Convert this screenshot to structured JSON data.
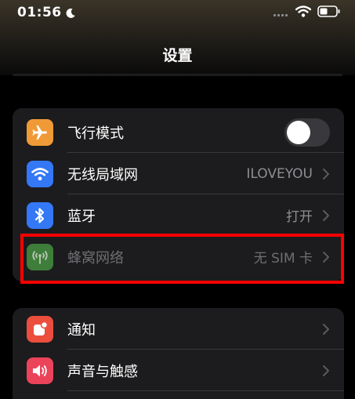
{
  "status_bar": {
    "time": "01:56",
    "focus_icon": "moon-icon",
    "signal_icon": "signal-icon",
    "wifi_icon": "wifi-icon",
    "battery_icon": "battery-icon"
  },
  "nav": {
    "title": "设置"
  },
  "group1": [
    {
      "icon": "airplane-icon",
      "icon_bg": "#f09a37",
      "label": "飞行模式",
      "control": "toggle",
      "toggle_on": false
    },
    {
      "icon": "wifi-icon",
      "icon_bg": "#3478f6",
      "label": "无线局域网",
      "value": "ILOVEYOU"
    },
    {
      "icon": "bluetooth-icon",
      "icon_bg": "#3478f6",
      "label": "蓝牙",
      "value": "打开"
    },
    {
      "icon": "cellular-icon",
      "icon_bg": "#3f7d3a",
      "label": "蜂窝网络",
      "value": "无 SIM 卡",
      "disabled": true
    }
  ],
  "group2": [
    {
      "icon": "notification-icon",
      "icon_bg": "#eb4e3d",
      "label": "通知"
    },
    {
      "icon": "sound-icon",
      "icon_bg": "#eb445a",
      "label": "声音与触感"
    }
  ],
  "colors": {
    "background": "#000000",
    "group_bg": "#1c1c1e",
    "secondary_text": "#8e8e93",
    "highlight": "#ff0000"
  }
}
